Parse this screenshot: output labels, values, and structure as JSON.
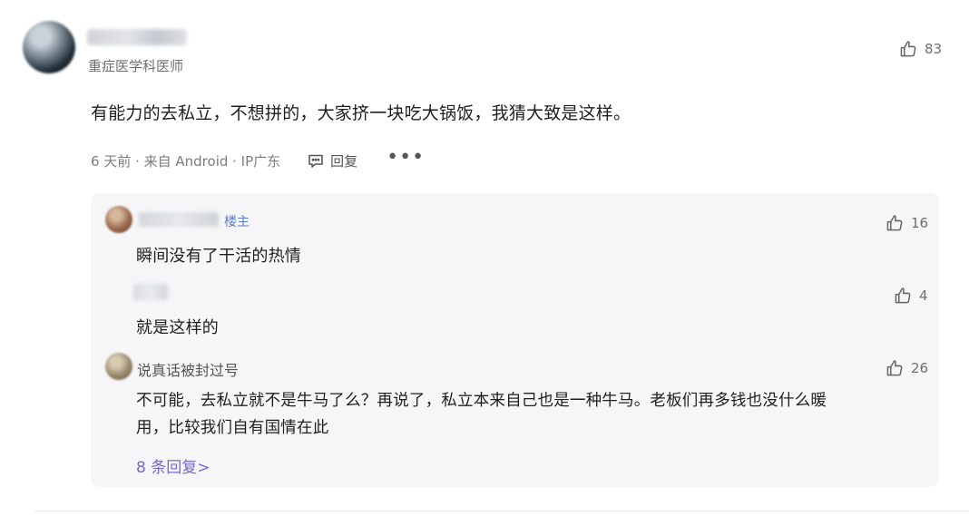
{
  "main_comment": {
    "author_title": "重症医学科医师",
    "likes": "83",
    "text": "有能力的去私立，不想拼的，大家挤一块吃大锅饭，我猜大致是这样。",
    "meta": "6 天前 · 来自 Android · IP广东",
    "reply_label": "回复",
    "more_label": "•••"
  },
  "replies": [
    {
      "badge": "楼主",
      "likes": "16",
      "text": "瞬间没有了干活的热情"
    },
    {
      "likes": "4",
      "text": "就是这样的"
    },
    {
      "name": "说真话被封过号",
      "likes": "26",
      "text_line1": "不可能，去私立就不是牛马了么？再说了，私立本来自己也是一种牛马。老板们再多钱也没什么暖",
      "text_line2": "用，比较我们自有国情在此"
    }
  ],
  "more_replies_label": "8 条回复>",
  "colors": {
    "accent_purple": "#7a68c8",
    "op_badge_blue": "#5b7ec6",
    "panel_bg": "#f6f6f8"
  },
  "icons": [
    "thumbs-up-icon",
    "comment-bubble-icon",
    "more-dots-icon"
  ]
}
